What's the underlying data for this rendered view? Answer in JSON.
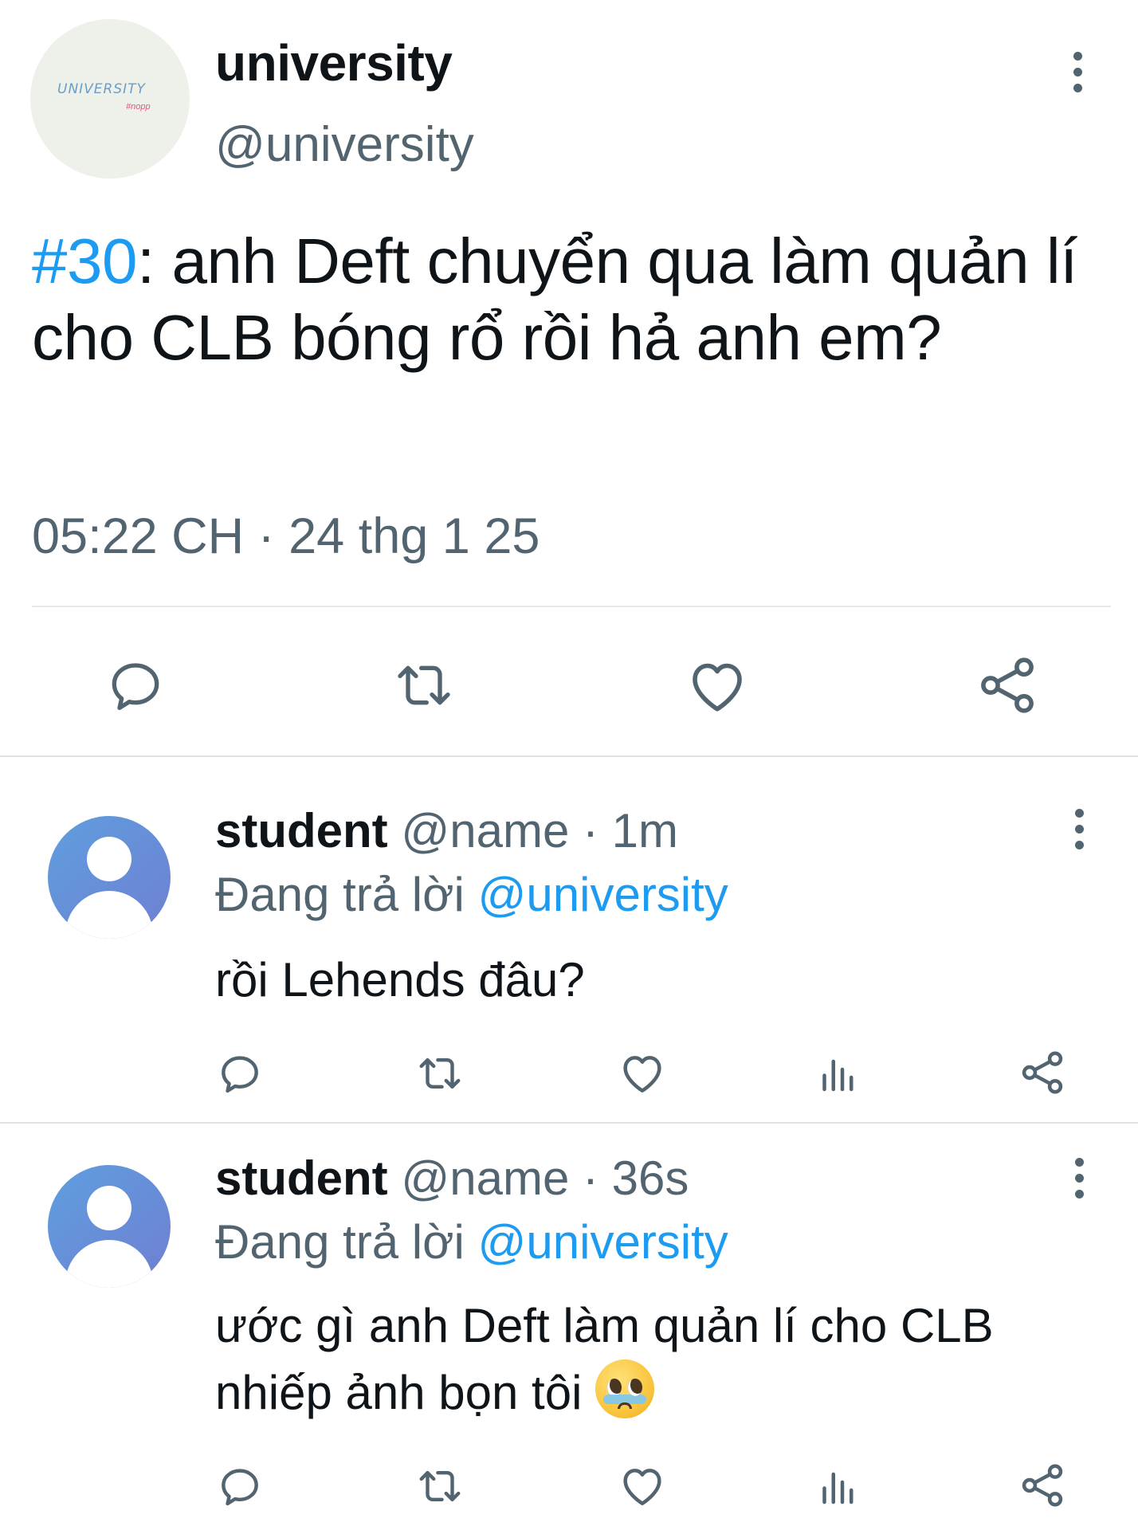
{
  "main_tweet": {
    "avatar_logo_text": "UNIVERSITY",
    "avatar_logo_sub": "#nopp",
    "display_name": "university",
    "handle": "@university",
    "hashtag": "#30",
    "text_after_hashtag": ": anh Deft chuyển qua làm quản lí cho CLB bóng rổ rồi hả anh em?",
    "timestamp": "05:22 CH · 24 thg 1 25",
    "actions": [
      "reply-icon",
      "retweet-icon",
      "like-icon",
      "share-icon"
    ]
  },
  "replies": [
    {
      "display_name": "student",
      "handle": "@name",
      "time": "1m",
      "replying_prefix": "Đang trả lời",
      "replying_to": "@university",
      "text": "rồi Lehends đâu?",
      "actions": [
        "reply-icon",
        "retweet-icon",
        "like-icon",
        "views-icon",
        "share-icon"
      ]
    },
    {
      "display_name": "student",
      "handle": "@name",
      "time": "36s",
      "replying_prefix": "Đang trả lời",
      "replying_to": "@university",
      "text": "ước gì anh Deft làm quản lí cho CLB nhiếp ảnh bọn tôi",
      "emoji": "pleading-face-with-tears-emoji",
      "actions": [
        "reply-icon",
        "retweet-icon",
        "like-icon",
        "views-icon",
        "share-icon"
      ]
    }
  ],
  "colors": {
    "accent": "#1d9bf0",
    "secondary_text": "#536471",
    "icon": "#536471",
    "divider": "#e6e9ec"
  }
}
